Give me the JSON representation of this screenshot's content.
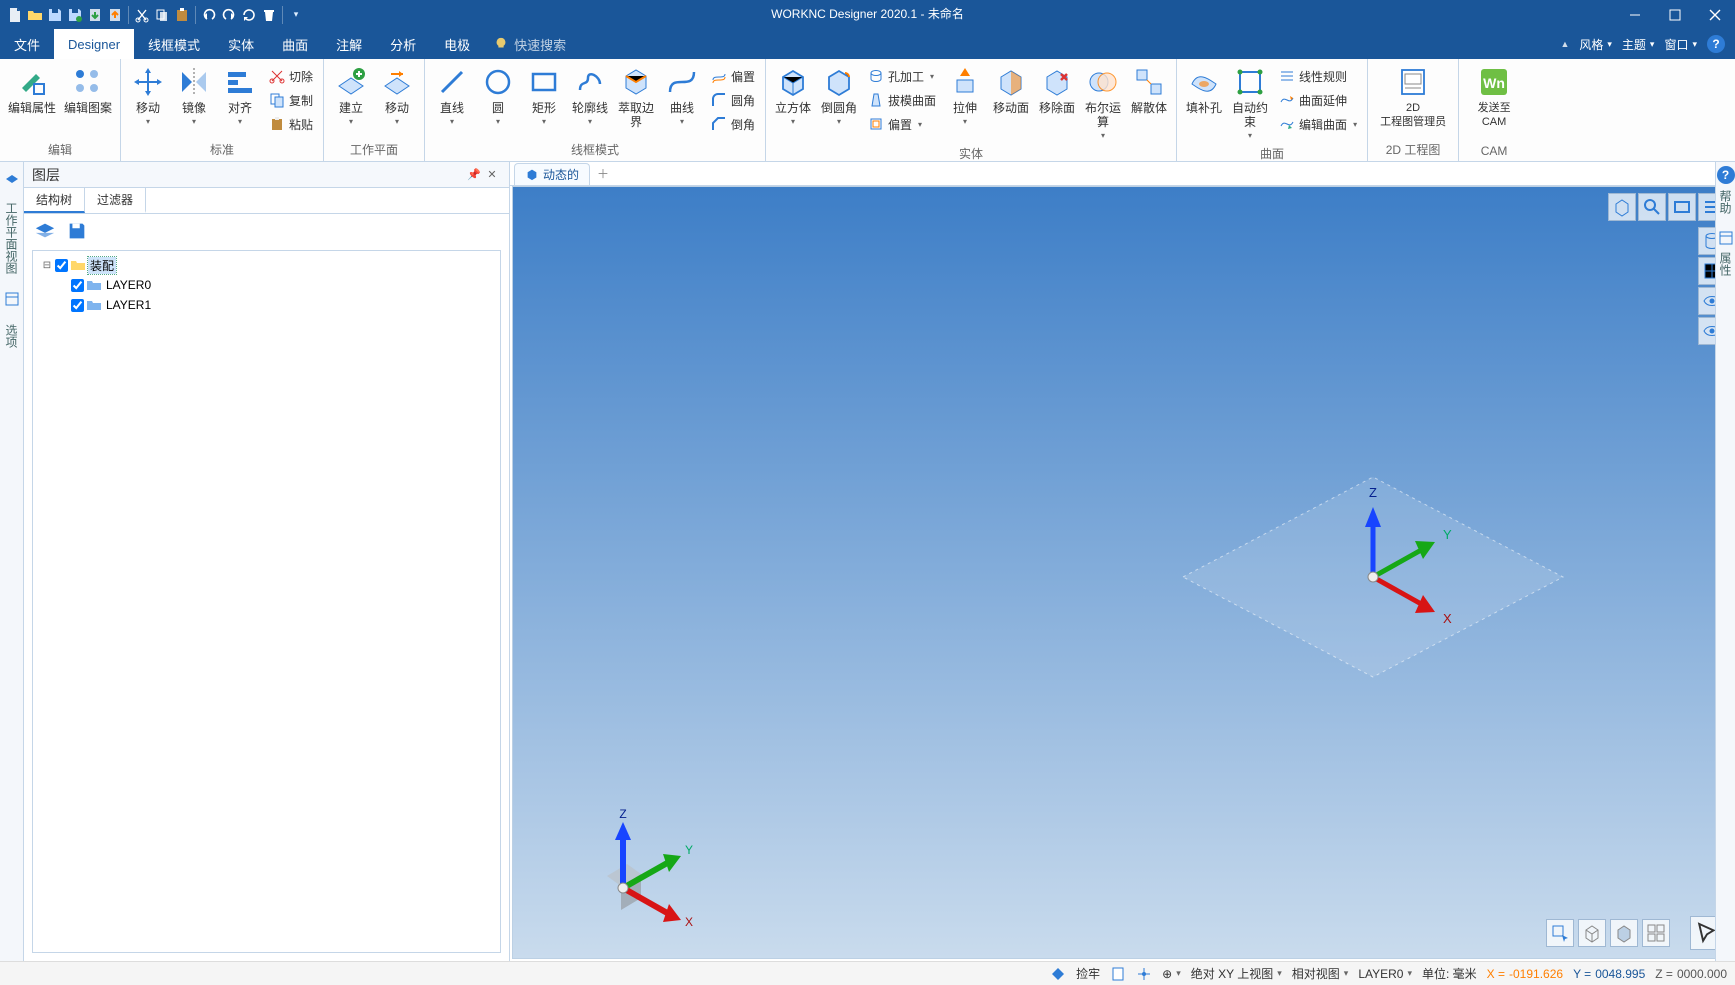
{
  "app": {
    "title": "WORKNC Designer 2020.1 - 未命名"
  },
  "qat": {
    "items": [
      "new",
      "open",
      "save",
      "save-as",
      "import",
      "export",
      "cut",
      "copy",
      "paste",
      "undo",
      "redo",
      "refresh",
      "delete"
    ],
    "overflow": "▾"
  },
  "menu": {
    "tabs": [
      {
        "id": "file",
        "label": "文件"
      },
      {
        "id": "designer",
        "label": "Designer"
      },
      {
        "id": "wireframe",
        "label": "线框模式"
      },
      {
        "id": "solid",
        "label": "实体"
      },
      {
        "id": "surface",
        "label": "曲面"
      },
      {
        "id": "annotate",
        "label": "注解"
      },
      {
        "id": "analyze",
        "label": "分析"
      },
      {
        "id": "electrode",
        "label": "电极"
      }
    ],
    "active": "designer",
    "search_placeholder": "快速搜索",
    "right": {
      "style": "风格",
      "theme": "主题",
      "window": "窗口",
      "help": "?"
    }
  },
  "ribbon": {
    "groups": [
      {
        "id": "edit",
        "label": "编辑",
        "big": [
          {
            "id": "edit-attr",
            "label": "编辑属性",
            "icon": "pencil-cube"
          },
          {
            "id": "edit-pattern",
            "label": "编辑图案",
            "icon": "pattern"
          }
        ]
      },
      {
        "id": "std",
        "label": "标准",
        "big": [
          {
            "id": "move",
            "label": "移动",
            "icon": "move-arrows",
            "drop": true
          },
          {
            "id": "mirror",
            "label": "镜像",
            "icon": "mirror",
            "drop": true
          },
          {
            "id": "align",
            "label": "对齐",
            "icon": "align",
            "drop": true
          }
        ],
        "small": [
          {
            "id": "cut",
            "label": "切除",
            "icon": "scissors"
          },
          {
            "id": "copy",
            "label": "复制",
            "icon": "copy"
          },
          {
            "id": "paste",
            "label": "粘贴",
            "icon": "paste"
          }
        ]
      },
      {
        "id": "wp",
        "label": "工作平面",
        "big": [
          {
            "id": "wp-create",
            "label": "建立",
            "icon": "plane-plus",
            "drop": true
          },
          {
            "id": "wp-move",
            "label": "移动",
            "icon": "plane-move",
            "drop": true
          }
        ]
      },
      {
        "id": "wf",
        "label": "线框模式",
        "big": [
          {
            "id": "line",
            "label": "直线",
            "icon": "line",
            "drop": true
          },
          {
            "id": "circle",
            "label": "圆",
            "icon": "circle",
            "drop": true
          },
          {
            "id": "rect",
            "label": "矩形",
            "icon": "rect",
            "drop": true
          },
          {
            "id": "contour",
            "label": "轮廓线",
            "icon": "contour",
            "drop": true
          },
          {
            "id": "extract",
            "label": "萃取边界",
            "icon": "extract"
          },
          {
            "id": "curve",
            "label": "曲线",
            "icon": "curve",
            "drop": true
          }
        ],
        "small": [
          {
            "id": "offset",
            "label": "偏置",
            "icon": "offset"
          },
          {
            "id": "fillet",
            "label": "圆角",
            "icon": "fillet"
          },
          {
            "id": "chamfer",
            "label": "倒角",
            "icon": "chamfer"
          }
        ]
      },
      {
        "id": "solid",
        "label": "实体",
        "big": [
          {
            "id": "cube",
            "label": "立方体",
            "icon": "cube",
            "drop": true
          },
          {
            "id": "round",
            "label": "倒圆角",
            "icon": "round",
            "drop": true
          }
        ],
        "small": [
          {
            "id": "hole",
            "label": "孔加工",
            "icon": "hole",
            "drop": true
          },
          {
            "id": "draft",
            "label": "拔模曲面",
            "icon": "draft"
          },
          {
            "id": "offset-s",
            "label": "偏置",
            "icon": "offset",
            "drop": true
          }
        ],
        "big2": [
          {
            "id": "extrude",
            "label": "拉伸",
            "icon": "extrude",
            "drop": true
          },
          {
            "id": "moveface",
            "label": "移动面",
            "icon": "moveface"
          },
          {
            "id": "delface",
            "label": "移除面",
            "icon": "delface"
          },
          {
            "id": "boolean",
            "label": "布尔运算",
            "icon": "boolean",
            "drop": true
          },
          {
            "id": "explode",
            "label": "解散体",
            "icon": "explode"
          }
        ]
      },
      {
        "id": "surf",
        "label": "曲面",
        "big": [
          {
            "id": "fillhole",
            "label": "填补孔",
            "icon": "fillhole"
          },
          {
            "id": "autoconstr",
            "label": "自动约束",
            "icon": "autoconstr",
            "drop": true
          }
        ],
        "small": [
          {
            "id": "ruled",
            "label": "线性规则",
            "icon": "ruled"
          },
          {
            "id": "extend",
            "label": "曲面延伸",
            "icon": "extend"
          },
          {
            "id": "editsurf",
            "label": "编辑曲面",
            "icon": "editsurf",
            "drop": true
          }
        ]
      },
      {
        "id": "dwg",
        "label": "2D 工程图",
        "big": [
          {
            "id": "dwgmgr",
            "label": "2D\n工程图管理员",
            "icon": "dwg"
          }
        ]
      },
      {
        "id": "cam",
        "label": "CAM",
        "big": [
          {
            "id": "sendcam",
            "label": "发送至\nCAM",
            "icon": "wn"
          }
        ]
      }
    ]
  },
  "panel": {
    "title": "图层",
    "tabs": [
      {
        "id": "tree",
        "label": "结构树"
      },
      {
        "id": "filter",
        "label": "过滤器"
      }
    ],
    "active": "tree",
    "tree": {
      "root": {
        "label": "装配",
        "checked": true,
        "expanded": true,
        "selected": true
      },
      "children": [
        {
          "label": "LAYER0",
          "checked": true
        },
        {
          "label": "LAYER1",
          "checked": true
        }
      ]
    }
  },
  "side_rail": {
    "items": [
      {
        "id": "wp",
        "label": "工作平面视图"
      },
      {
        "id": "sel",
        "label": "选项"
      }
    ]
  },
  "right_rail": {
    "items": [
      {
        "id": "help",
        "label": "帮助"
      },
      {
        "id": "props",
        "label": "属性"
      }
    ]
  },
  "viewport": {
    "tabs": [
      {
        "id": "dyn",
        "label": "动态的"
      }
    ],
    "axes": {
      "x": "X",
      "y": "Y",
      "z": "Z"
    }
  },
  "statusbar": {
    "snap": "捡牢",
    "view": "绝对 XY 上视图",
    "relview": "相对视图",
    "layer": "LAYER0",
    "units": "单位: 毫米",
    "coords": {
      "x_label": "X =",
      "x_value": "-0191.626",
      "y_label": "Y =",
      "y_value": "0048.995",
      "z_label": "Z =",
      "z_value": "0000.000"
    }
  }
}
